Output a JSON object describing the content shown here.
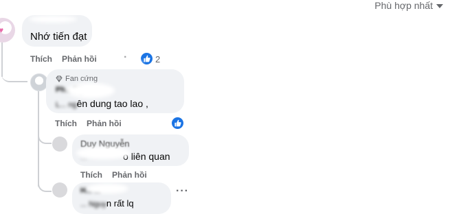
{
  "sort": {
    "label": "Phù hợp nhất"
  },
  "comments": [
    {
      "author": "",
      "text": "Nhớ tiến đạt",
      "actions": {
        "like": "Thích",
        "reply": "Phản hồi"
      },
      "reaction_count": "2"
    },
    {
      "badge": "Fan cứng",
      "author": "Ph... Ng...",
      "text_prefix": "L... ng",
      "text": "ên dung tao lao ,",
      "actions": {
        "like": "Thích",
        "reply": "Phản hồi"
      }
    },
    {
      "author": "Duy Nguyễn",
      "text_prefix": "...",
      "text": "o liên quan",
      "actions": {
        "like": "Thích",
        "reply": "Phản hồi"
      }
    },
    {
      "author": "H... ...",
      "text_prefix": "... Nguy",
      "text": "n rất lq"
    }
  ],
  "icons": {
    "sort": "caret-down-icon",
    "like": "like-thumb-icon",
    "fan": "diamond-icon",
    "more": "more-icon"
  },
  "colors": {
    "bubble": "#f0f2f5",
    "meta": "#65676b",
    "like_blue": "#1b74e4",
    "thread_line": "#ced0d4"
  }
}
